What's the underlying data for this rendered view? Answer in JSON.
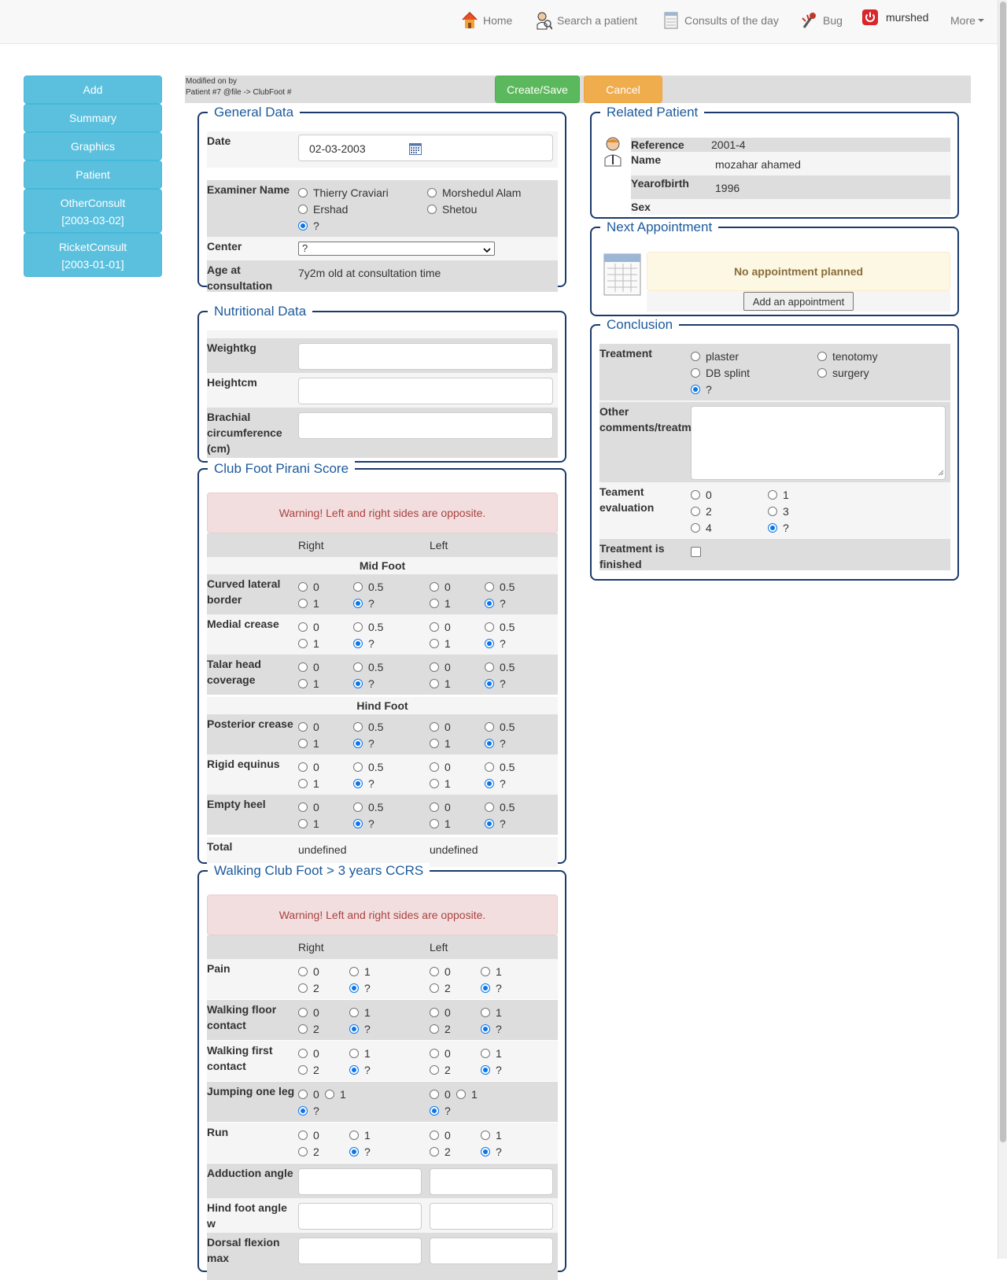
{
  "nav": {
    "home": "Home",
    "search": "Search a patient",
    "consults": "Consults of the day",
    "bug": "Bug",
    "user": "murshed",
    "more": "More"
  },
  "sidebar": [
    {
      "l1": "Add",
      "l2": ""
    },
    {
      "l1": "Summary",
      "l2": ""
    },
    {
      "l1": "Graphics",
      "l2": ""
    },
    {
      "l1": "Patient",
      "l2": ""
    },
    {
      "l1": "OtherConsult",
      "l2": "[2003-03-02]"
    },
    {
      "l1": "RicketConsult",
      "l2": "[2003-01-01]"
    }
  ],
  "topbar": {
    "meta1": "Modified on by",
    "meta2": "Patient #7 @file -> ClubFoot #",
    "create": "Create/Save",
    "cancel": "Cancel"
  },
  "general": {
    "legend": "General Data",
    "date_label": "Date",
    "date_value": "02-03-2003",
    "examiner_label": "Examiner Name",
    "examiners": [
      "Thierry Craviari",
      "Morshedul Alam",
      "Ershad",
      "Shetou",
      "?"
    ],
    "center_label": "Center",
    "center_value": "?",
    "age_label1": "Age at",
    "age_label2": "consultation",
    "age_value": "7y2m old at consultation time"
  },
  "nutritional": {
    "legend": "Nutritional Data",
    "weight": "Weightkg",
    "height": "Heightcm",
    "brachial1": "Brachial",
    "brachial2": "circumference",
    "brachial3": "(cm)"
  },
  "pirani": {
    "legend": "Club Foot Pirani Score",
    "warning": "Warning! Left and right sides are opposite.",
    "right": "Right",
    "left": "Left",
    "mid": "Mid Foot",
    "hind": "Hind Foot",
    "opts": [
      "0",
      "0.5",
      "1",
      "?"
    ],
    "rows": [
      [
        "Curved lateral",
        "border"
      ],
      [
        "Medial crease",
        ""
      ],
      [
        "Talar head",
        "coverage"
      ],
      [
        "Posterior crease",
        ""
      ],
      [
        "Rigid equinus",
        ""
      ],
      [
        "Empty heel",
        ""
      ]
    ],
    "total": "Total",
    "total_right": "undefined",
    "total_left": "undefined"
  },
  "walking": {
    "legend": "Walking Club Foot > 3 years CCRS",
    "warning": "Warning! Left and right sides are opposite.",
    "right": "Right",
    "left": "Left",
    "opts": [
      "0",
      "1",
      "2",
      "?"
    ],
    "rows": [
      [
        "Pain",
        ""
      ],
      [
        "Walking floor",
        "contact"
      ],
      [
        "Walking first",
        "contact"
      ],
      [
        "Jumping one leg",
        ""
      ],
      [
        "Run",
        ""
      ]
    ],
    "adduction": "Adduction angle",
    "hindfoot1": "Hind foot angle",
    "hindfoot2": "w",
    "dorsal1": "Dorsal flexion",
    "dorsal2": "max"
  },
  "related": {
    "legend": "Related Patient",
    "reference_label": "Reference",
    "reference": "2001-4",
    "name_label": "Name",
    "name": "mozahar ahamed",
    "yob_label": "Yearofbirth",
    "yob": "1996",
    "sex_label": "Sex"
  },
  "appointment": {
    "legend": "Next Appointment",
    "none": "No appointment planned",
    "add": "Add an appointment"
  },
  "conclusion": {
    "legend": "Conclusion",
    "treatment_label": "Treatment",
    "treatments": [
      "plaster",
      "tenotomy",
      "DB splint",
      "surgery",
      "?"
    ],
    "other1": "Other",
    "other2": "comments/treatm",
    "eval1": "Teament",
    "eval2": "evaluation",
    "evals": [
      "0",
      "1",
      "2",
      "3",
      "4",
      "?"
    ],
    "finished1": "Treatment is",
    "finished2": "finished"
  }
}
